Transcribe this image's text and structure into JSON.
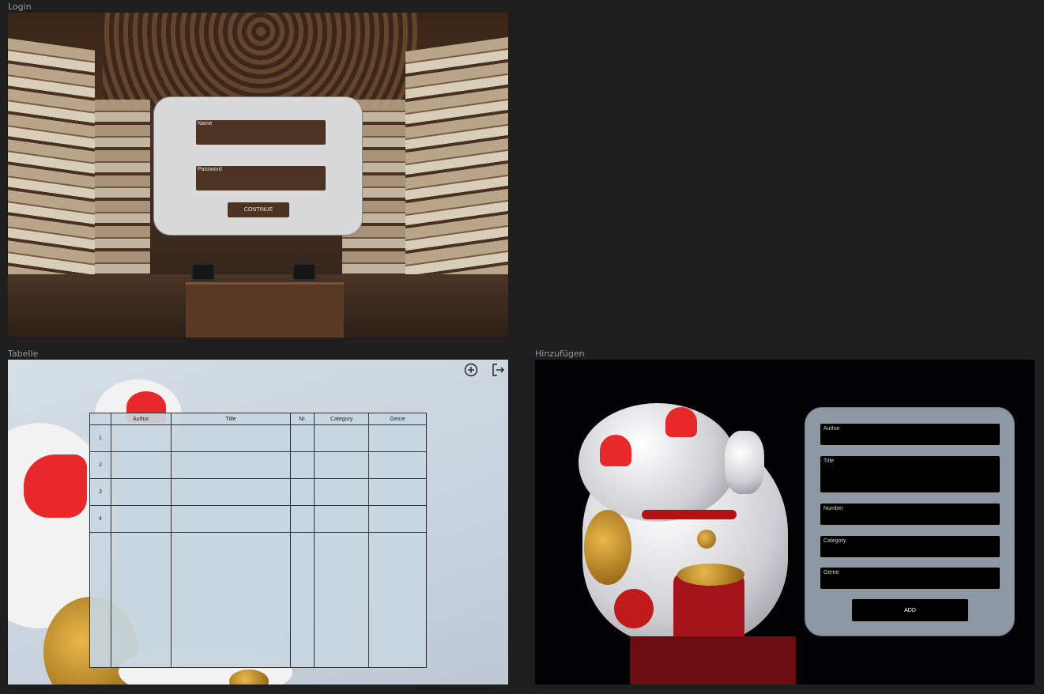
{
  "frames": {
    "login": "Login",
    "tabelle": "Tabelle",
    "hinzufuegen": "Hinzufügen"
  },
  "login": {
    "name_label": "Name",
    "password_label": "Password",
    "continue_label": "CONTINUE"
  },
  "tabelle": {
    "icons": [
      "add-circle-icon",
      "logout-icon"
    ],
    "columns": [
      "",
      "Author",
      "Title",
      "Nr.",
      "Category",
      "Genre"
    ],
    "rows": [
      "1",
      "2",
      "3",
      "4"
    ]
  },
  "hinzufuegen": {
    "author_label": "Author",
    "title_label": "Title",
    "number_label": "Number",
    "category_label": "Category",
    "genre_label": "Genre",
    "add_label": "ADD"
  },
  "colors": {
    "login_brown": "#4c3323",
    "card_grey": "#d9d9d9",
    "add_card": "#8e98a4"
  }
}
